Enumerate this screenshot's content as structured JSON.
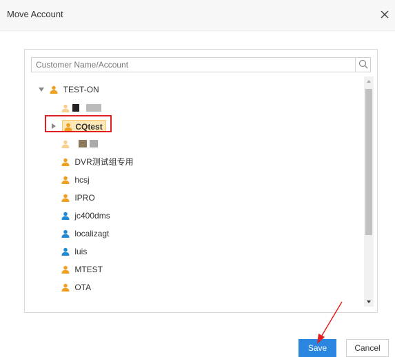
{
  "dialog": {
    "title": "Move Account",
    "close_glyph": "×"
  },
  "search": {
    "placeholder": "Customer Name/Account",
    "icon": "search-icon"
  },
  "tree": {
    "root": {
      "label": "TEST-ON",
      "expanded": true,
      "icon_color": "#f0a020"
    },
    "children": [
      {
        "label": "",
        "obscured": true,
        "icon_color": "#f0a020"
      },
      {
        "label": "CQtest",
        "selected": true,
        "collapsed": true,
        "icon_color": "#f0a020"
      },
      {
        "label": "",
        "obscured": true,
        "icon_color": "#f0a020"
      },
      {
        "label": "DVR测试组专用",
        "icon_color": "#f0a020"
      },
      {
        "label": "hcsj",
        "icon_color": "#f0a020"
      },
      {
        "label": "IPRO",
        "icon_color": "#f0a020"
      },
      {
        "label": "jc400dms",
        "icon_color": "#1e8ad6"
      },
      {
        "label": "localizagt",
        "icon_color": "#1e8ad6"
      },
      {
        "label": "luis",
        "icon_color": "#1e8ad6"
      },
      {
        "label": "MTEST",
        "icon_color": "#f0a020"
      },
      {
        "label": "OTA",
        "icon_color": "#f0a020"
      }
    ]
  },
  "buttons": {
    "save": "Save",
    "cancel": "Cancel"
  },
  "colors": {
    "accent": "#2b86e0",
    "highlight_border": "#e02020",
    "user_orange": "#f0a020",
    "user_blue": "#1e8ad6"
  }
}
